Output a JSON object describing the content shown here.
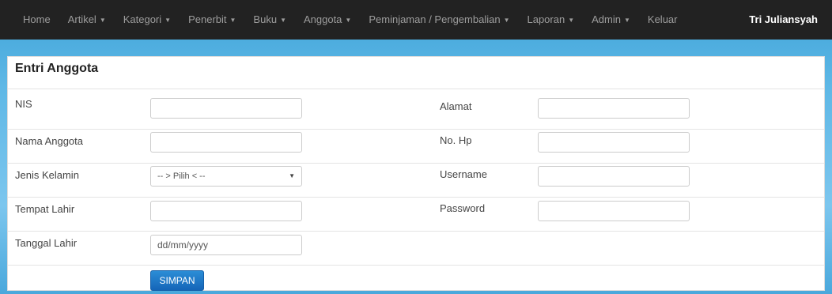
{
  "nav": {
    "items": [
      {
        "label": "Home",
        "caret": ""
      },
      {
        "label": "Artikel",
        "caret": "▼"
      },
      {
        "label": "Kategori",
        "caret": "▼"
      },
      {
        "label": "Penerbit",
        "caret": "▼"
      },
      {
        "label": "Buku",
        "caret": "▼"
      },
      {
        "label": "Anggota",
        "caret": "▼"
      },
      {
        "label": "Peminjaman / Pengembalian",
        "caret": "▼"
      },
      {
        "label": "Laporan",
        "caret": "▼"
      },
      {
        "label": "Admin",
        "caret": "▼"
      },
      {
        "label": "Keluar",
        "caret": ""
      }
    ],
    "user": "Tri Juliansyah"
  },
  "form": {
    "title": "Entri Anggota",
    "fields_left": [
      {
        "label": "NIS",
        "value": ""
      },
      {
        "label": "Nama Anggota",
        "value": ""
      },
      {
        "label": "Jenis Kelamin",
        "value": "-- > Pilih < --"
      },
      {
        "label": "Tempat Lahir",
        "value": ""
      },
      {
        "label": "Tanggal Lahir",
        "value": "dd/mm/yyyy"
      }
    ],
    "fields_right": [
      {
        "label": "Alamat",
        "value": ""
      },
      {
        "label": "No. Hp",
        "value": ""
      },
      {
        "label": "Username",
        "value": ""
      },
      {
        "label": "Password",
        "value": ""
      }
    ],
    "submit_label": "SIMPAN"
  },
  "colors": {
    "navbar": "#222222",
    "button": "#1e78c8",
    "background": "#5fb8e6"
  }
}
